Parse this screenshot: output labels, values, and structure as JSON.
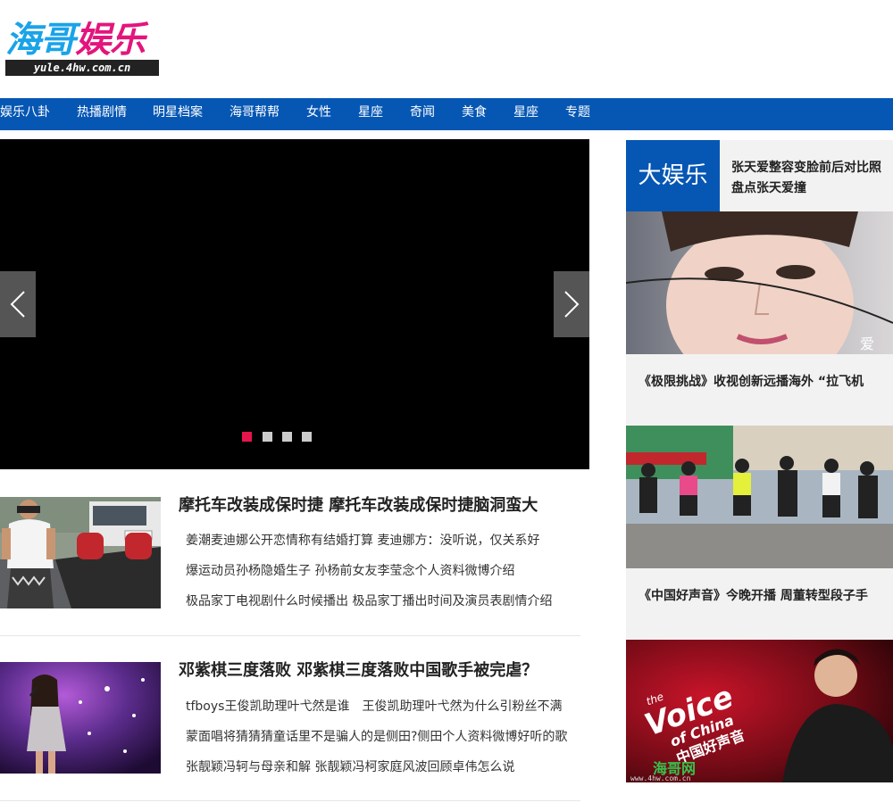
{
  "logo": {
    "main_part1": "海哥",
    "main_part2": "娱乐",
    "domain": "yule.4hw.com.cn"
  },
  "nav": [
    "娱乐八卦",
    "热播剧情",
    "明星档案",
    "海哥帮帮",
    "女性",
    "星座",
    "奇闻",
    "美食",
    "星座",
    "专题"
  ],
  "slider": {
    "slide_count": 4,
    "active_slide": 1
  },
  "news": [
    {
      "title": "摩托车改装成保时捷 摩托车改装成保时捷脑洞蛮大",
      "links": [
        "姜潮麦迪娜公开恋情称有结婚打算 麦迪娜方：没听说，仅关系好",
        "爆运动员孙杨隐婚生子 孙杨前女友李莹念个人资料微博介绍",
        "极品家丁电视剧什么时候播出 极品家丁播出时间及演员表剧情介绍"
      ]
    },
    {
      "title": "邓紫棋三度落败 邓紫棋三度落败中国歌手被完虐？",
      "links": [
        "tfboys王俊凯助理叶弋然是谁　王俊凯助理叶弋然为什么引粉丝不满",
        "蒙面唱将猜猜猜童话里不是骗人的是侧田?侧田个人资料微博好听的歌",
        "张靓颖冯轲与母亲和解 张靓颖冯柯家庭风波回顾卓伟怎么说"
      ]
    }
  ],
  "sidebar": {
    "badge": "大娱乐",
    "headline": "张天爱整容变脸前后对比照 盘点张天爱撞",
    "image1_watermark": "爱",
    "caption1": "《极限挑战》收视创新远播海外 “拉飞机",
    "caption2": "《中国好声音》今晚开播 周董转型段子手",
    "image3_logo_line1": "the",
    "image3_logo_line2": "Voice",
    "image3_logo_line3": "of China",
    "image3_logo_cn": "中国好声音",
    "image3_stamp": "海哥网",
    "image3_url": "www.4hw.com.cn"
  }
}
